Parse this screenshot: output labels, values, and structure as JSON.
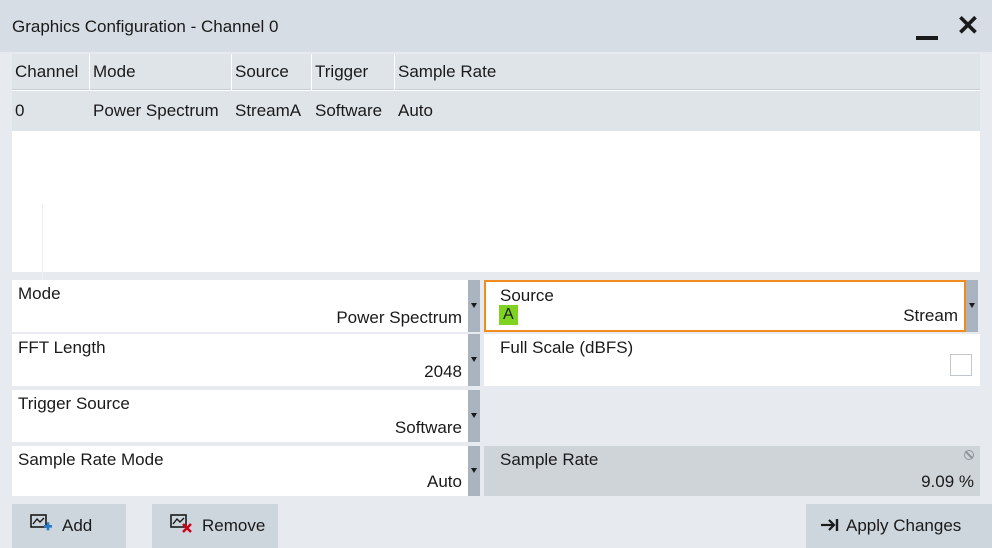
{
  "window": {
    "title": "Graphics Configuration - Channel 0"
  },
  "table": {
    "columns": [
      "Channel",
      "Mode",
      "Source",
      "Trigger",
      "Sample Rate"
    ],
    "rows": [
      [
        "0",
        "Power Spectrum",
        "StreamA",
        "Software",
        "Auto"
      ]
    ]
  },
  "form": {
    "mode": {
      "label": "Mode",
      "value": "Power Spectrum"
    },
    "source": {
      "label": "Source",
      "badge": "A",
      "value": "Stream"
    },
    "fft_length": {
      "label": "FFT Length",
      "value": "2048"
    },
    "full_scale": {
      "label": "Full Scale (dBFS)",
      "checked": false
    },
    "trigger_source": {
      "label": "Trigger Source",
      "value": "Software"
    },
    "sample_rate_mode": {
      "label": "Sample Rate Mode",
      "value": "Auto"
    },
    "sample_rate": {
      "label": "Sample Rate",
      "value": "9.09 %"
    }
  },
  "footer": {
    "add_label": "Add",
    "remove_label": "Remove",
    "apply_label": "Apply Changes"
  },
  "colors": {
    "accent_orange": "#f08c1e",
    "stream_badge_green": "#7ed321",
    "title_bar": "#d6dde4"
  },
  "icons": {
    "add": "add-channel-icon",
    "remove": "remove-channel-icon",
    "apply": "arrow-to-bar-icon",
    "minimize": "minimize-icon",
    "close": "close-icon",
    "dropdown": "chevron-down-icon",
    "readonly": "no-entry-icon"
  }
}
